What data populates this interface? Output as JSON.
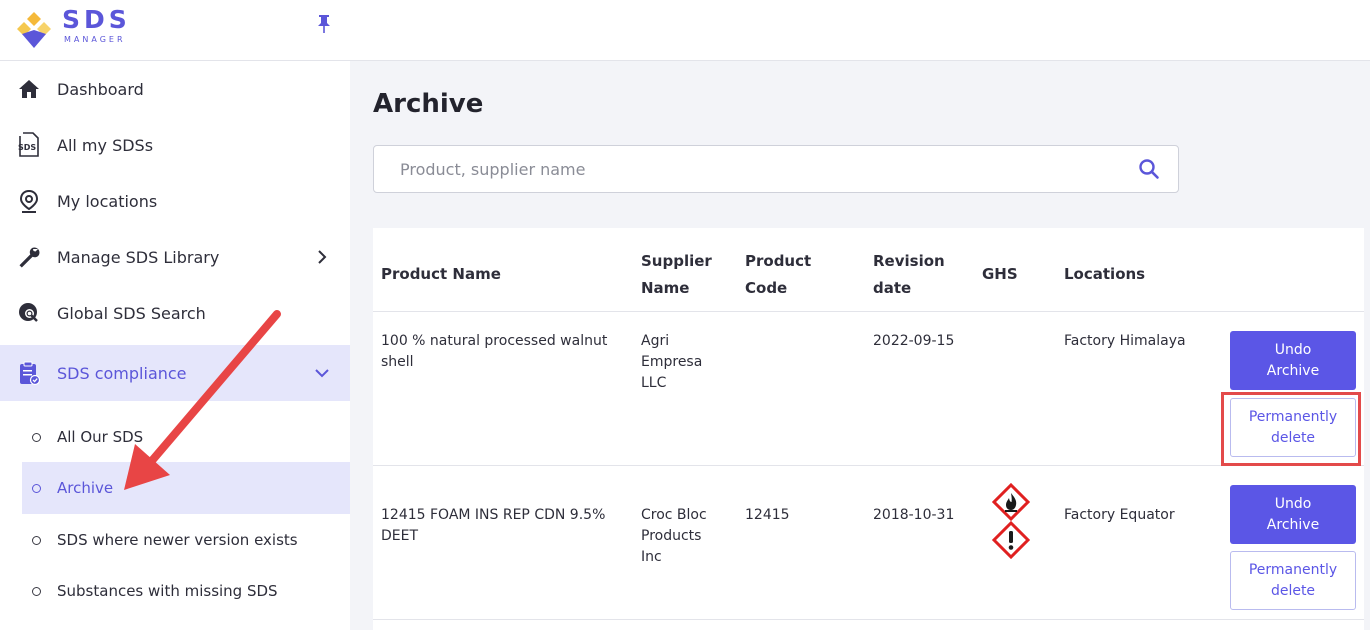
{
  "brand": {
    "name": "SDS",
    "subtitle": "MANAGER"
  },
  "sidebar": {
    "items": [
      {
        "label": "Dashboard",
        "icon": "home-icon"
      },
      {
        "label": "All my SDSs",
        "icon": "sds-file-icon"
      },
      {
        "label": "My locations",
        "icon": "location-pin-icon"
      },
      {
        "label": "Manage SDS Library",
        "icon": "wrench-icon"
      },
      {
        "label": "Global SDS Search",
        "icon": "globe-search-icon"
      },
      {
        "label": "SDS compliance",
        "icon": "clipboard-check-icon"
      }
    ],
    "subitems": [
      {
        "label": "All Our SDS"
      },
      {
        "label": "Archive"
      },
      {
        "label": "SDS where newer version exists"
      },
      {
        "label": "Substances with missing SDS"
      }
    ]
  },
  "main": {
    "title": "Archive",
    "search": {
      "placeholder": "Product, supplier name"
    },
    "table": {
      "headers": {
        "product_name": "Product Name",
        "supplier_name_1": "Supplier",
        "supplier_name_2": "Name",
        "product_code_1": "Product",
        "product_code_2": "Code",
        "revision_1": "Revision",
        "revision_2": "date",
        "ghs": "GHS",
        "locations": "Locations"
      },
      "rows": [
        {
          "product_1": "100 % natural processed walnut",
          "product_2": "shell",
          "supplier_1": "Agri",
          "supplier_2": "Empresa",
          "supplier_3": "LLC",
          "code": "",
          "revision": "2022-09-15",
          "location": "Factory Himalaya",
          "undo_1": "Undo",
          "undo_2": "Archive",
          "del_1": "Permanently",
          "del_2": "delete"
        },
        {
          "product_1": "12415 FOAM INS REP CDN 9.5%",
          "product_2": "DEET",
          "supplier_1": "Croc Bloc",
          "supplier_2": "Products",
          "supplier_3": "Inc",
          "code": "12415",
          "revision": "2018-10-31",
          "location": "Factory Equator",
          "undo_1": "Undo",
          "undo_2": "Archive",
          "del_1": "Permanently",
          "del_2": "delete"
        }
      ]
    }
  },
  "colors": {
    "accent": "#5b56e6",
    "active_bg": "#e5e6fb",
    "highlight": "#e34a4a",
    "arrow": "#e84545",
    "ghs_red": "#e02020"
  }
}
